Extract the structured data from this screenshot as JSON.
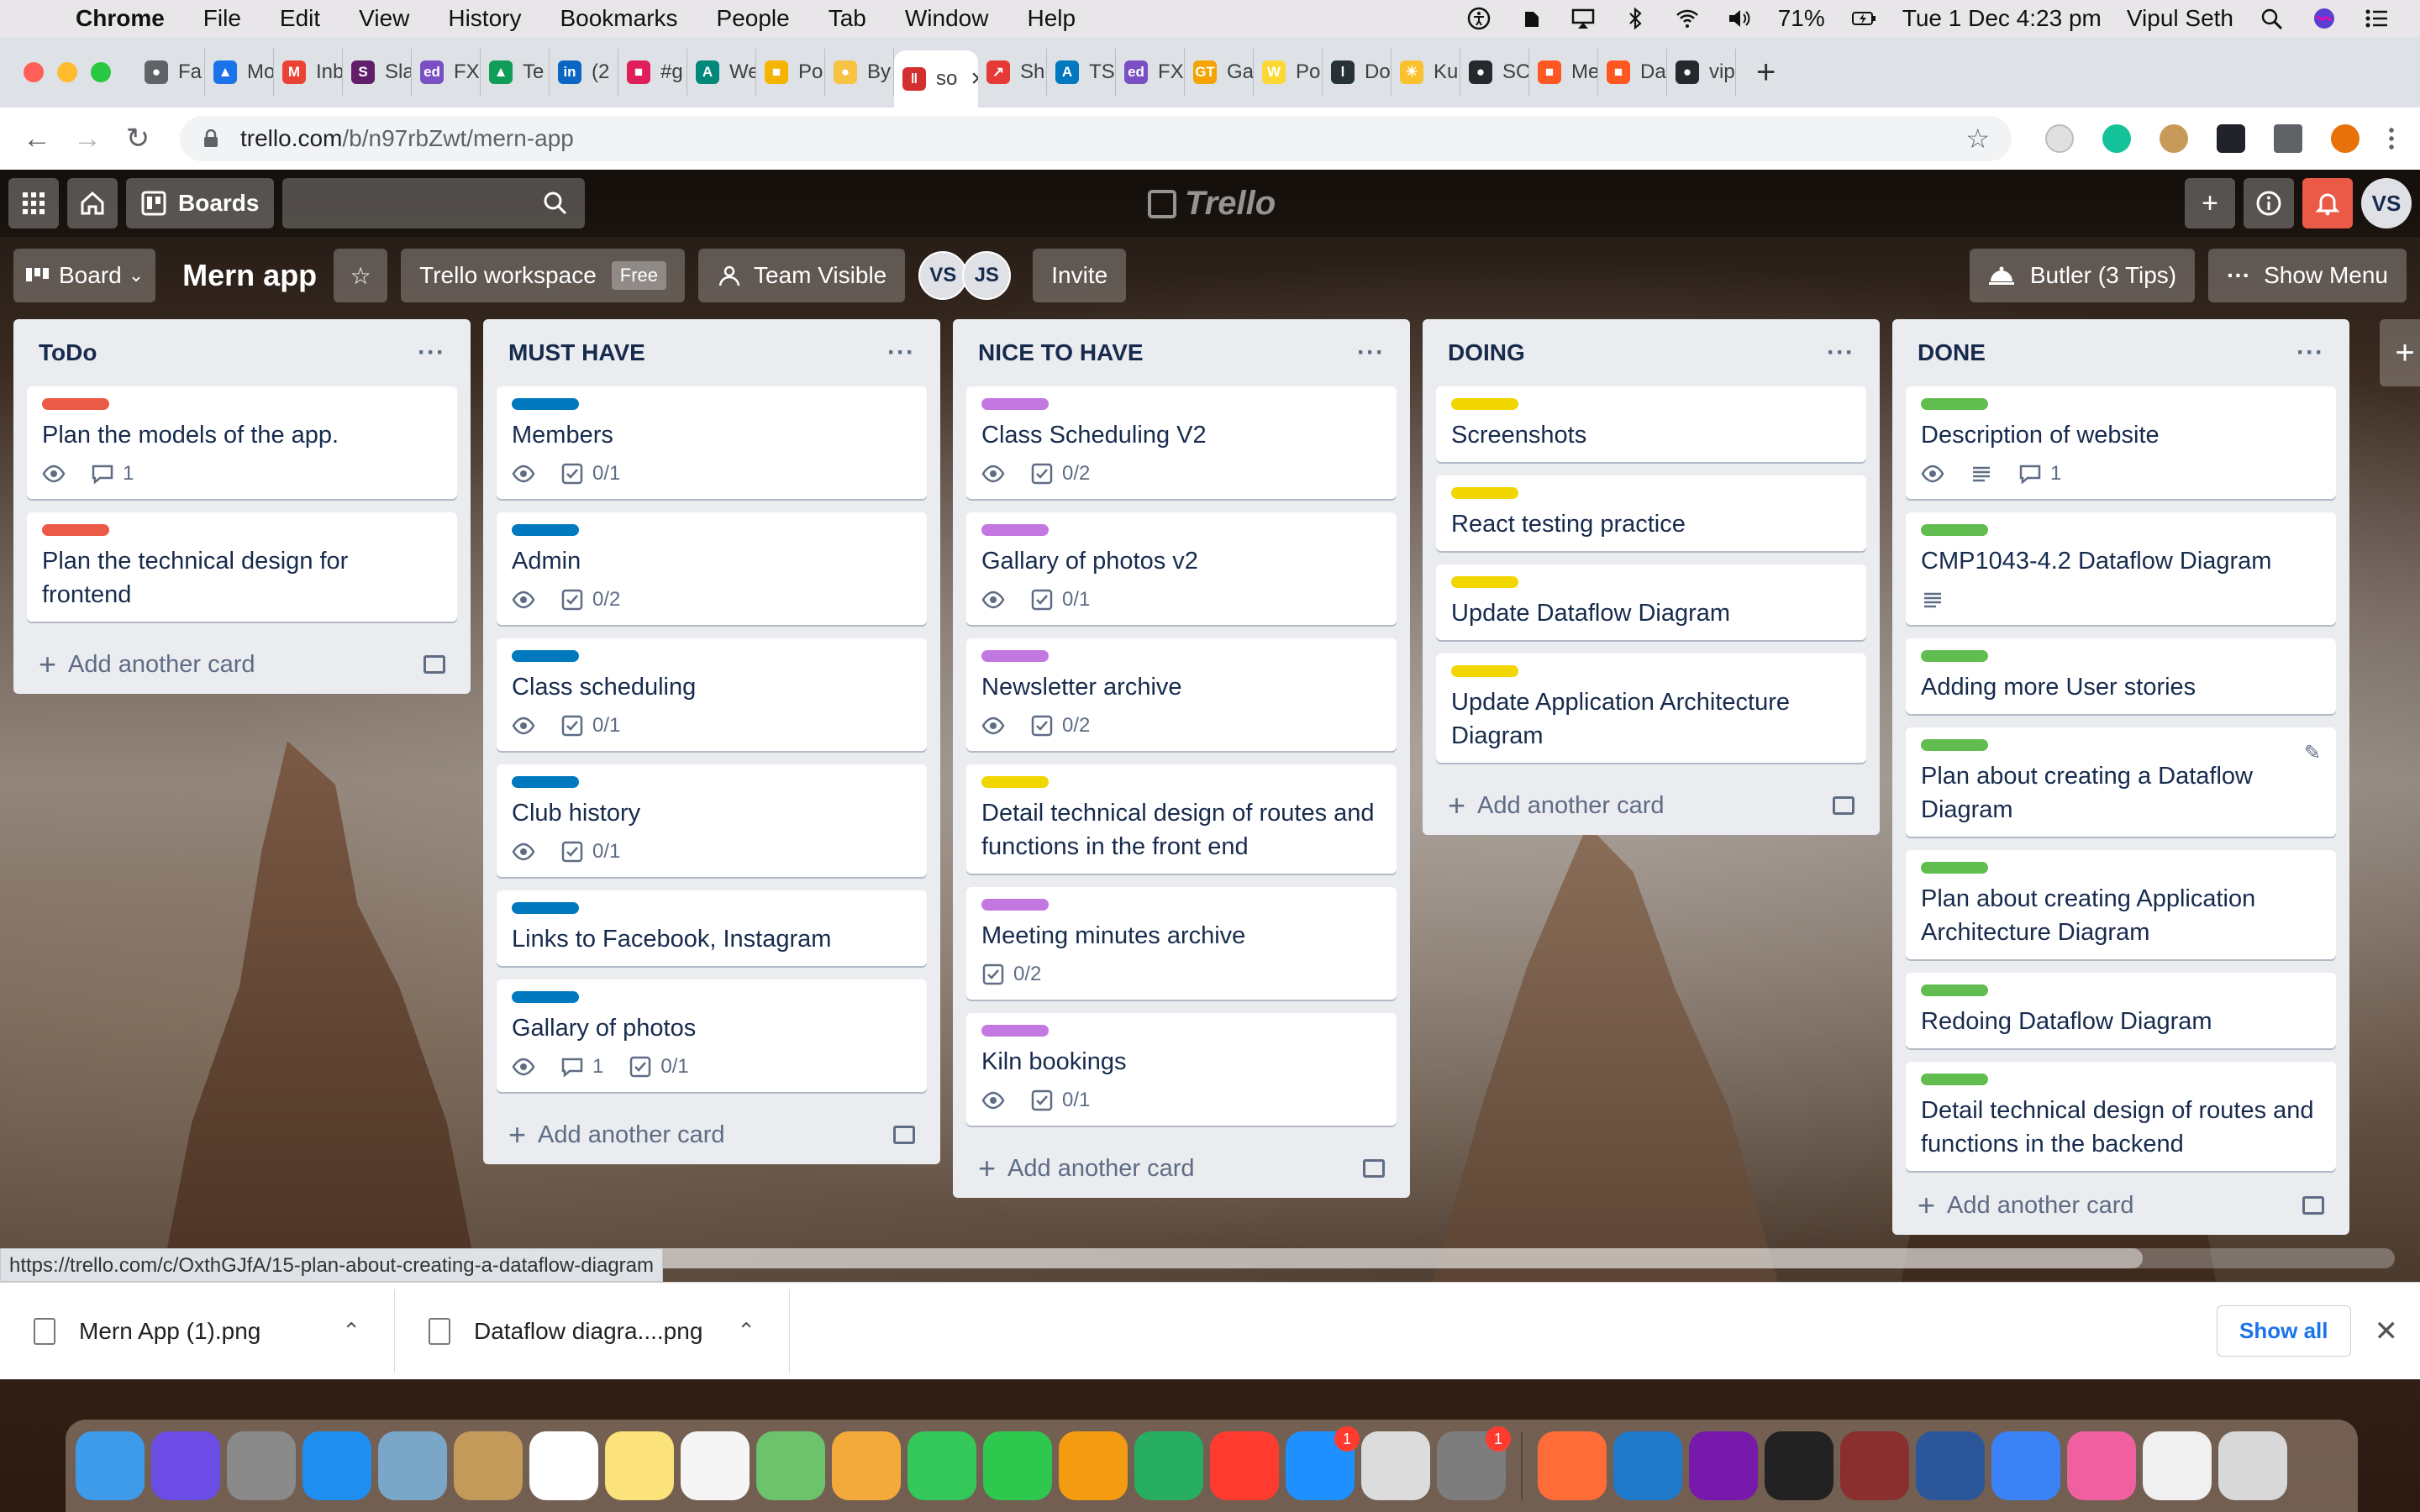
{
  "menubar": {
    "app": "Chrome",
    "items": [
      "File",
      "Edit",
      "View",
      "History",
      "Bookmarks",
      "People",
      "Tab",
      "Window",
      "Help"
    ],
    "battery": "71%",
    "datetime": "Tue 1 Dec  4:23 pm",
    "user": "Vipul Seth"
  },
  "tabs": [
    {
      "label": "Fa",
      "color": "#5f6368",
      "glyph": "●"
    },
    {
      "label": "Mo",
      "color": "#1a73e8",
      "glyph": "▲"
    },
    {
      "label": "Inb",
      "color": "#ea4335",
      "glyph": "M"
    },
    {
      "label": "Sla",
      "color": "#611f69",
      "glyph": "S"
    },
    {
      "label": "FX",
      "color": "#7b4fc4",
      "glyph": "ed"
    },
    {
      "label": "Te",
      "color": "#0f9d58",
      "glyph": "▲"
    },
    {
      "label": "(2",
      "color": "#0a66c2",
      "glyph": "in"
    },
    {
      "label": "#g",
      "color": "#e01e5a",
      "glyph": "■"
    },
    {
      "label": "We",
      "color": "#00897b",
      "glyph": "A"
    },
    {
      "label": "Po",
      "color": "#f4b400",
      "glyph": "■"
    },
    {
      "label": "By",
      "color": "#f6c343",
      "glyph": "●"
    },
    {
      "label": "so",
      "color": "#d32f2f",
      "glyph": "‖"
    },
    {
      "label": "Sh",
      "color": "#e53935",
      "glyph": "↗"
    },
    {
      "label": "TS",
      "color": "#0079bf",
      "glyph": "A"
    },
    {
      "label": "FX",
      "color": "#7b4fc4",
      "glyph": "ed"
    },
    {
      "label": "Ga",
      "color": "#f4a300",
      "glyph": "GT"
    },
    {
      "label": "Po",
      "color": "#fdd835",
      "glyph": "W"
    },
    {
      "label": "Do",
      "color": "#263238",
      "glyph": "l"
    },
    {
      "label": "Ku",
      "color": "#fbc02d",
      "glyph": "☀"
    },
    {
      "label": "SC",
      "color": "#24292e",
      "glyph": "●"
    },
    {
      "label": "Me",
      "color": "#ff5722",
      "glyph": "■"
    },
    {
      "label": "Da",
      "color": "#ff5722",
      "glyph": "■"
    },
    {
      "label": "vip",
      "color": "#24292e",
      "glyph": "●"
    }
  ],
  "url": {
    "host": "trello.com",
    "path": "/b/n97rbZwt/mern-app"
  },
  "trello": {
    "boards_label": "Boards",
    "logo": "Trello",
    "avatar": "VS"
  },
  "boardbar": {
    "view": "Board",
    "title": "Mern app",
    "workspace": "Trello workspace",
    "free": "Free",
    "visibility": "Team Visible",
    "members": [
      "VS",
      "JS"
    ],
    "invite": "Invite",
    "butler": "Butler (3 Tips)",
    "show_menu": "Show Menu"
  },
  "add_card_label": "Add another card",
  "lists": [
    {
      "title": "ToDo",
      "cards": [
        {
          "label": "#eb5a46",
          "title": "Plan the models of the app.",
          "watch": true,
          "comments": "1"
        },
        {
          "label": "#eb5a46",
          "title": "Plan the technical design for frontend"
        }
      ]
    },
    {
      "title": "MUST HAVE",
      "cards": [
        {
          "label": "#0079bf",
          "title": "Members",
          "watch": true,
          "check": "0/1"
        },
        {
          "label": "#0079bf",
          "title": "Admin",
          "watch": true,
          "check": "0/2"
        },
        {
          "label": "#0079bf",
          "title": "Class scheduling",
          "watch": true,
          "check": "0/1"
        },
        {
          "label": "#0079bf",
          "title": "Club history",
          "watch": true,
          "check": "0/1"
        },
        {
          "label": "#0079bf",
          "title": "Links to Facebook, Instagram"
        },
        {
          "label": "#0079bf",
          "title": "Gallary of photos",
          "watch": true,
          "comments": "1",
          "check": "0/1"
        }
      ]
    },
    {
      "title": "NICE TO HAVE",
      "cards": [
        {
          "label": "#c377e0",
          "title": "Class Scheduling V2",
          "watch": true,
          "check": "0/2"
        },
        {
          "label": "#c377e0",
          "title": "Gallary of photos v2",
          "watch": true,
          "check": "0/1"
        },
        {
          "label": "#c377e0",
          "title": "Newsletter archive",
          "watch": true,
          "check": "0/2"
        },
        {
          "label": "#f2d600",
          "title": "Detail technical design of routes and functions in the front end"
        },
        {
          "label": "#c377e0",
          "title": "Meeting minutes archive",
          "check": "0/2"
        },
        {
          "label": "#c377e0",
          "title": "Kiln bookings",
          "watch": true,
          "check": "0/1"
        }
      ]
    },
    {
      "title": "DOING",
      "cards": [
        {
          "label": "#f2d600",
          "title": "Screenshots"
        },
        {
          "label": "#f2d600",
          "title": "React testing practice"
        },
        {
          "label": "#f2d600",
          "title": "Update Dataflow Diagram"
        },
        {
          "label": "#f2d600",
          "title": "Update Application Architecture Diagram"
        }
      ]
    },
    {
      "title": "DONE",
      "cards": [
        {
          "label": "#61bd4f",
          "title": "Description of website",
          "watch": true,
          "desc": true,
          "comments": "1"
        },
        {
          "label": "#61bd4f",
          "title": "CMP1043-4.2 Dataflow Diagram",
          "desc": true
        },
        {
          "label": "#61bd4f",
          "title": "Adding more User stories"
        },
        {
          "label": "#61bd4f",
          "title": "Plan about creating a Dataflow Diagram",
          "edit": true
        },
        {
          "label": "#61bd4f",
          "title": "Plan about creating Application Architecture Diagram"
        },
        {
          "label": "#61bd4f",
          "title": "Redoing Dataflow Diagram"
        },
        {
          "label": "#61bd4f",
          "title": "Detail technical design of routes and functions in the backend"
        }
      ]
    }
  ],
  "status_url": "https://trello.com/c/OxthGJfA/15-plan-about-creating-a-dataflow-diagram",
  "downloads": [
    {
      "name": "Mern App (1).png"
    },
    {
      "name": "Dataflow diagra....png"
    }
  ],
  "show_all": "Show all",
  "dock": [
    {
      "name": "finder",
      "color": "#3d9be9"
    },
    {
      "name": "siri",
      "color": "#6b4de6"
    },
    {
      "name": "launchpad",
      "color": "#8a8a8a"
    },
    {
      "name": "safari",
      "color": "#1f8ef1"
    },
    {
      "name": "mail-bird",
      "color": "#7aa7c7"
    },
    {
      "name": "contacts",
      "color": "#c49a5a"
    },
    {
      "name": "calendar",
      "color": "#ffffff"
    },
    {
      "name": "notes",
      "color": "#fbe27a"
    },
    {
      "name": "reminders",
      "color": "#f5f5f5"
    },
    {
      "name": "maps",
      "color": "#6cc36c"
    },
    {
      "name": "photos",
      "color": "#f4a93b"
    },
    {
      "name": "messages",
      "color": "#34c759"
    },
    {
      "name": "facetime",
      "color": "#2fc84f"
    },
    {
      "name": "pages",
      "color": "#f39c12"
    },
    {
      "name": "numbers",
      "color": "#27ae60"
    },
    {
      "name": "news",
      "color": "#ff3b30"
    },
    {
      "name": "app-store",
      "color": "#1e90ff",
      "badge": "1"
    },
    {
      "name": "chrome",
      "color": "#dcdcdc"
    },
    {
      "name": "system-preferences",
      "color": "#7d7d7d",
      "badge": "1"
    },
    {
      "name": "postman",
      "color": "#ff6c37"
    },
    {
      "name": "vscode",
      "color": "#1f7acc"
    },
    {
      "name": "onenote",
      "color": "#7719aa"
    },
    {
      "name": "terminal",
      "color": "#222222"
    },
    {
      "name": "dictionary",
      "color": "#8b2e2e"
    },
    {
      "name": "word",
      "color": "#2b579a"
    },
    {
      "name": "bluetooth",
      "color": "#3b82f6"
    },
    {
      "name": "itunes",
      "color": "#f05fa0"
    },
    {
      "name": "preview",
      "color": "#f0f0f0"
    },
    {
      "name": "trash",
      "color": "#d8d8d8"
    }
  ]
}
